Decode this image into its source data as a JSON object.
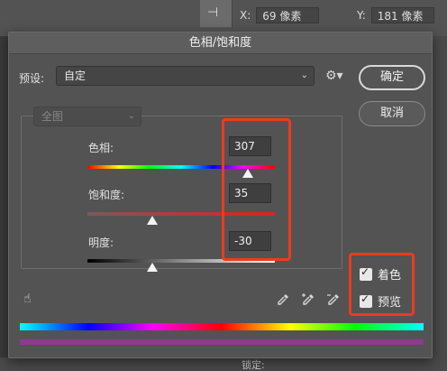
{
  "background": {
    "x_label": "X:",
    "x_value": "69 像素",
    "y_label": "Y:",
    "y_value": "181 像素",
    "bottom_hint": "锁定:"
  },
  "dialog": {
    "title": "色相/饱和度",
    "preset_label": "预设:",
    "preset_value": "自定",
    "ok_label": "确定",
    "cancel_label": "取消",
    "channel_value": "全图",
    "hue": {
      "label": "色相:",
      "value": "307",
      "range": [
        0,
        360
      ],
      "current": 307
    },
    "saturation": {
      "label": "饱和度:",
      "value": "35",
      "range": [
        0,
        100
      ],
      "current": 35
    },
    "lightness": {
      "label": "明度:",
      "value": "-30",
      "range": [
        -100,
        100
      ],
      "current": -30
    },
    "colorize_label": "着色",
    "colorize_checked": true,
    "preview_label": "预览",
    "preview_checked": true
  },
  "colors": {
    "highlight": "#ec3b1f",
    "dialog_bg": "#535353"
  },
  "icons": [
    "gear-icon",
    "hand-target-icon",
    "eyedropper-icon",
    "eyedropper-plus-icon",
    "eyedropper-minus-icon",
    "chevron-down-icon"
  ]
}
